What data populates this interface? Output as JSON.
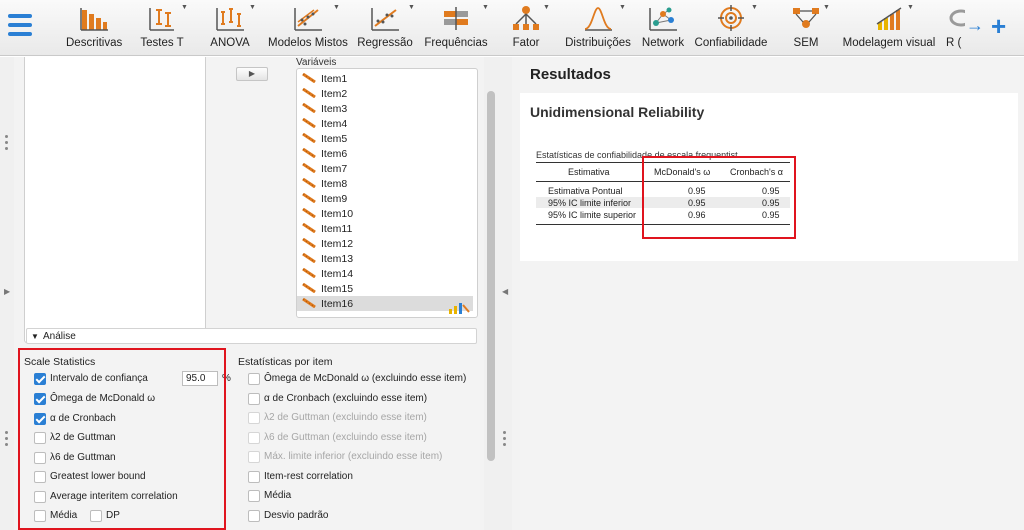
{
  "toolbar": {
    "items": [
      {
        "label": "Descritivas",
        "icon": "descriptives-bar-icon"
      },
      {
        "label": "Testes T",
        "icon": "t-test-icon"
      },
      {
        "label": "ANOVA",
        "icon": "anova-icon"
      },
      {
        "label": "Modelos Mistos",
        "icon": "mixed-models-icon"
      },
      {
        "label": "Regressão",
        "icon": "regression-icon"
      },
      {
        "label": "Frequências",
        "icon": "frequencies-icon"
      },
      {
        "label": "Fator",
        "icon": "factor-icon"
      },
      {
        "label": "Distribuições",
        "icon": "distributions-icon"
      },
      {
        "label": "Network",
        "icon": "network-icon"
      },
      {
        "label": "Confiabilidade",
        "icon": "reliability-icon"
      },
      {
        "label": "SEM",
        "icon": "sem-icon"
      },
      {
        "label": "Modelagem visual",
        "icon": "visual-modeling-icon"
      },
      {
        "label": "R (",
        "icon": "r-icon"
      }
    ],
    "accent": "#2a7fd4"
  },
  "variables": {
    "title": "Variáveis",
    "items": [
      "Item1",
      "Item2",
      "Item3",
      "Item4",
      "Item5",
      "Item6",
      "Item7",
      "Item8",
      "Item9",
      "Item10",
      "Item11",
      "Item12",
      "Item13",
      "Item14",
      "Item15",
      "Item16"
    ],
    "selected": "Item16"
  },
  "analysis": {
    "header": "Análise"
  },
  "scale_statistics": {
    "title": "Scale Statistics",
    "ci_label": "Intervalo de confiança",
    "ci_value": "95.0",
    "ci_unit": "%",
    "options": [
      {
        "label": "Ômega de McDonald ω",
        "checked": true
      },
      {
        "label": "α de Cronbach",
        "checked": true
      },
      {
        "label": "λ2 de Guttman",
        "checked": false
      },
      {
        "label": "λ6 de Guttman",
        "checked": false
      },
      {
        "label": "Greatest lower bound",
        "checked": false
      },
      {
        "label": "Average interitem correlation",
        "checked": false
      }
    ],
    "mean_label": "Média",
    "sd_label": "DP"
  },
  "item_statistics": {
    "title": "Estatísticas por item",
    "options": [
      {
        "label": "Ômega de McDonald ω (excluindo esse item)",
        "enabled": true
      },
      {
        "label": "α de Cronbach (excluindo esse item)",
        "enabled": true
      },
      {
        "label": "λ2 de Guttman (excluindo esse item)",
        "enabled": false
      },
      {
        "label": "λ6 de Guttman (excluindo esse item)",
        "enabled": false
      },
      {
        "label": "Máx. limite inferior (excluindo esse item)",
        "enabled": false
      },
      {
        "label": "Item-rest correlation",
        "enabled": true
      },
      {
        "label": "Média",
        "enabled": true
      },
      {
        "label": "Desvio padrão",
        "enabled": true
      }
    ]
  },
  "results": {
    "title": "Resultados",
    "subtitle": "Unidimensional Reliability",
    "table_caption": "Estatísticas de confiabilidade de escala frequentist",
    "headers": [
      "Estimativa",
      "McDonald's ω",
      "Cronbach's α"
    ],
    "rows": [
      [
        "Estimativa Pontual",
        "0.95",
        "0.95"
      ],
      [
        "95% IC limite inferior",
        "0.95",
        "0.95"
      ],
      [
        "95% IC limite superior",
        "0.96",
        "0.95"
      ]
    ]
  }
}
